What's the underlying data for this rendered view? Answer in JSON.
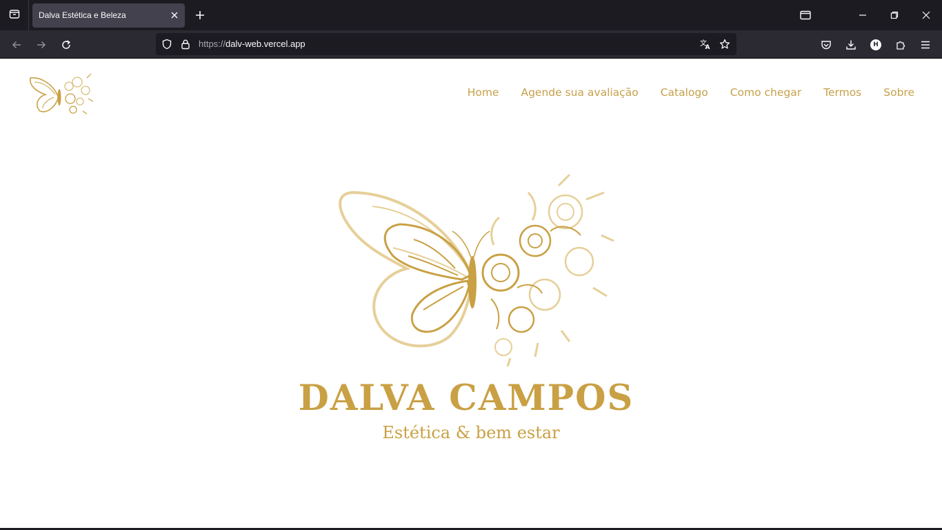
{
  "browser": {
    "tab": {
      "title": "Dalva Estética e Beleza"
    },
    "url": {
      "protocol": "https://",
      "host": "dalv-web.vercel.app"
    },
    "profile_initial": "H",
    "icons": [
      "list-all-tabs-icon",
      "close-icon",
      "plus-icon",
      "folder-icon",
      "minimize-icon",
      "restore-icon",
      "close-window-icon",
      "back-arrow-icon",
      "forward-arrow-icon",
      "reload-icon",
      "shield-icon",
      "lock-icon",
      "translate-icon",
      "star-icon",
      "pocket-icon",
      "download-icon",
      "extensions-icon",
      "menu-icon"
    ]
  },
  "site": {
    "nav": [
      {
        "label": "Home"
      },
      {
        "label": "Agende sua avaliação"
      },
      {
        "label": "Catalogo"
      },
      {
        "label": "Como chegar"
      },
      {
        "label": "Termos"
      },
      {
        "label": "Sobre"
      }
    ],
    "brand": {
      "name": "DALVA CAMPOS",
      "tagline": "Estética & bem estar"
    },
    "colors": {
      "gold": "#c9a043",
      "light_gold": "#e6cf98",
      "chrome_dark": "#1c1b22",
      "chrome_mid": "#2b2a33"
    }
  }
}
